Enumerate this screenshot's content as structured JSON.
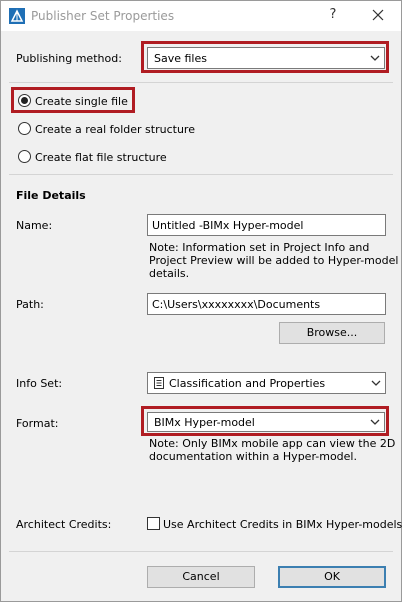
{
  "window": {
    "title": "Publisher Set Properties",
    "help_glyph": "?"
  },
  "publishing": {
    "label": "Publishing method:",
    "value": "Save files"
  },
  "structure_options": [
    {
      "label": "Create single file",
      "selected": true
    },
    {
      "label": "Create a real folder structure",
      "selected": false
    },
    {
      "label": "Create flat file structure",
      "selected": false
    }
  ],
  "file_details": {
    "heading": "File Details",
    "name_label": "Name:",
    "name_value": "Untitled -BIMx Hyper-model",
    "name_note_1": "Note: Information set in Project Info and",
    "name_note_2": "Project Preview will be added to Hyper-model",
    "name_note_3": "details.",
    "path_label": "Path:",
    "path_value": "C:\\Users\\xxxxxxxx\\Documents",
    "browse_label": "Browse..."
  },
  "info_set": {
    "label": "Info Set:",
    "value": "Classification and Properties"
  },
  "format": {
    "label": "Format:",
    "value": "BIMx Hyper-model",
    "note_1": "Note: Only BIMx mobile app can view the 2D",
    "note_2": "documentation within a Hyper-model."
  },
  "architect_credits": {
    "label": "Architect Credits:",
    "checkbox_label": "Use Architect Credits in BIMx Hyper-models.",
    "checked": false
  },
  "buttons": {
    "cancel": "Cancel",
    "ok": "OK"
  },
  "colors": {
    "highlight": "#b01c22",
    "default_button_border": "#3c7fb1",
    "dialog_bg": "#f0f0f0"
  },
  "icons": {
    "app": "archicad-app-icon",
    "close": "close-icon",
    "dropdown": "chevron-down-icon",
    "info_set": "document-list-icon"
  }
}
